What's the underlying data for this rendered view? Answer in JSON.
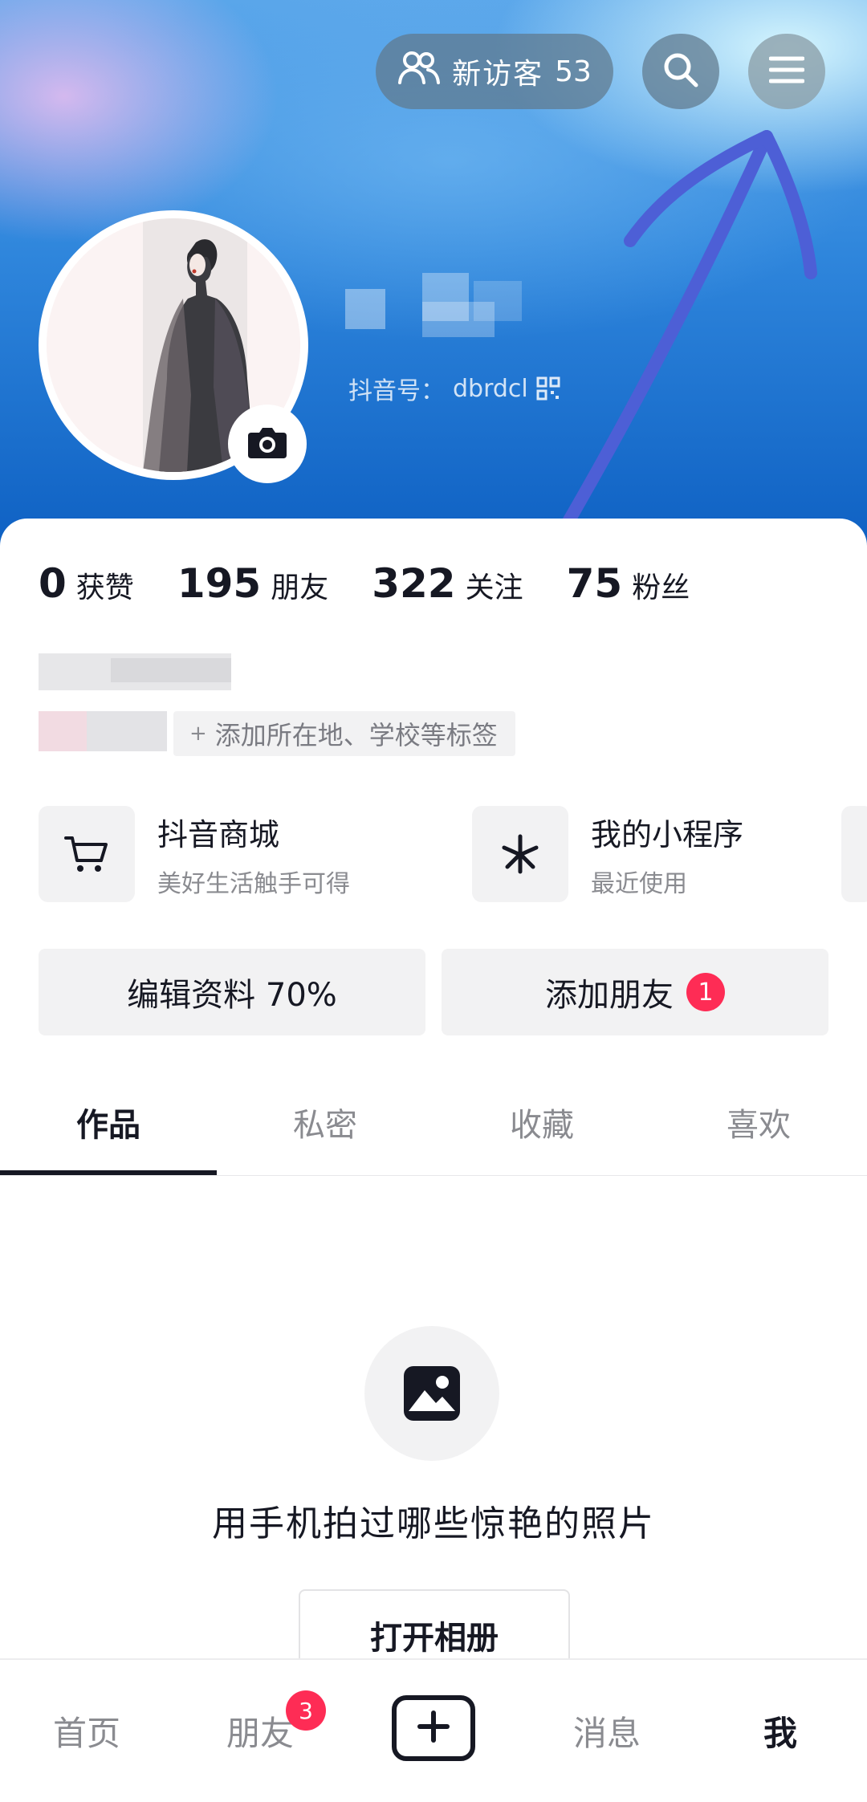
{
  "header": {
    "visitors_label": "新访客",
    "visitors_count": "53"
  },
  "profile": {
    "douyin_id_label": "抖音号：",
    "douyin_id": "dbrdcl"
  },
  "stats": [
    {
      "value": "0",
      "label": "获赞"
    },
    {
      "value": "195",
      "label": "朋友"
    },
    {
      "value": "322",
      "label": "关注"
    },
    {
      "value": "75",
      "label": "粉丝"
    }
  ],
  "tag_chip": "添加所在地、学校等标签",
  "tools": [
    {
      "title": "抖音商城",
      "subtitle": "美好生活触手可得",
      "icon": "cart-icon"
    },
    {
      "title": "我的小程序",
      "subtitle": "最近使用",
      "icon": "mini-program-icon"
    }
  ],
  "actions": {
    "edit_profile": "编辑资料 70%",
    "add_friends": "添加朋友",
    "add_friends_badge": "1"
  },
  "tabs": [
    {
      "label": "作品",
      "active": true
    },
    {
      "label": "私密",
      "active": false
    },
    {
      "label": "收藏",
      "active": false
    },
    {
      "label": "喜欢",
      "active": false
    }
  ],
  "empty_state": {
    "message": "用手机拍过哪些惊艳的照片",
    "button": "打开相册",
    "icon": "image-icon"
  },
  "bottom_nav": [
    {
      "label": "首页",
      "active": false
    },
    {
      "label": "朋友",
      "active": false,
      "badge": "3"
    },
    {
      "label": "",
      "icon": "plus-icon"
    },
    {
      "label": "消息",
      "active": false
    },
    {
      "label": "我",
      "active": true
    }
  ],
  "colors": {
    "accent_red": "#fe2c55",
    "annotation_arrow": "#4d5fd6",
    "text_primary": "#161823",
    "text_secondary": "#8a8b90"
  }
}
